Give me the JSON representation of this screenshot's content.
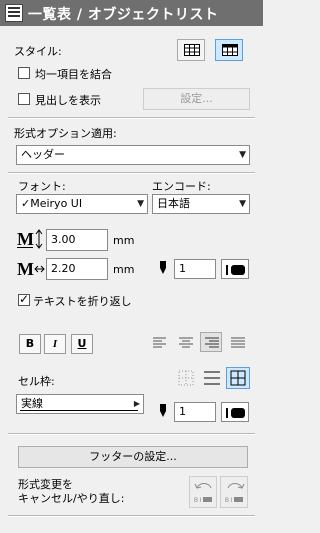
{
  "window": {
    "title": "一覧表 / オブジェクトリスト"
  },
  "style": {
    "label": "スタイル:",
    "merge_label": "均一項目を結合",
    "merge_checked": false,
    "header_label": "見出しを表示",
    "header_checked": false,
    "settings_button": "設定..."
  },
  "format_options": {
    "label": "形式オプション適用:",
    "selected": "ヘッダー"
  },
  "font": {
    "font_label": "フォント:",
    "font_value": "✓Meiryo UI",
    "encoding_label": "エンコード:",
    "encoding_value": "日本語",
    "height_value": "3.00",
    "height_unit": "mm",
    "width_value": "2.20",
    "width_unit": "mm",
    "pen_value": "1",
    "wrap_label": "テキストを折り返し",
    "wrap_checked": true,
    "bold_label": "B",
    "italic_label": "I",
    "underline_label": "U"
  },
  "cell_frame": {
    "label": "セル枠:",
    "line_type": "実線",
    "pen_value": "1"
  },
  "footer": {
    "settings_button": "フッターの設定...",
    "undo_line1": "形式変更を",
    "undo_line2": "キャンセル/やり直し:"
  }
}
